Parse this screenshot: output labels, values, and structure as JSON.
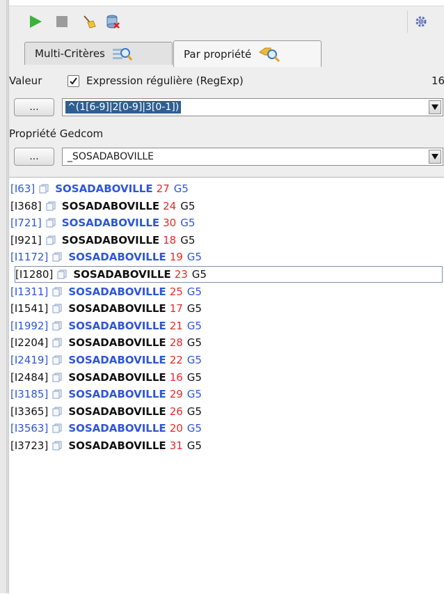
{
  "toolbar": {
    "icons": [
      "play-icon",
      "stop-icon",
      "broom-icon",
      "clear-database-icon",
      "settings-gear-icon"
    ]
  },
  "tabs": [
    {
      "label": "Multi-Critères",
      "icon": "magnifier-icon",
      "active": false
    },
    {
      "label": "Par propriété",
      "icon": "tag-magnifier-icon",
      "active": true
    }
  ],
  "form": {
    "value_label": "Valeur",
    "regexp_label": "Expression régulière (RegExp)",
    "regexp_checked": true,
    "count": "16",
    "value_button": "...",
    "value_field": "^(1[6-9]|2[0-9]|3[0-1])",
    "property_label": "Propriété Gedcom",
    "property_button": "...",
    "property_field": "_SOSADABOVILLE"
  },
  "results": [
    {
      "id": "[I63]",
      "prop": "SOSADABOVILLE",
      "num": "27",
      "gen": "G5",
      "color": "blue"
    },
    {
      "id": "[I368]",
      "prop": "SOSADABOVILLE",
      "num": "24",
      "gen": "G5",
      "color": "black"
    },
    {
      "id": "[I721]",
      "prop": "SOSADABOVILLE",
      "num": "30",
      "gen": "G5",
      "color": "blue"
    },
    {
      "id": "[I921]",
      "prop": "SOSADABOVILLE",
      "num": "18",
      "gen": "G5",
      "color": "black"
    },
    {
      "id": "[I1172]",
      "prop": "SOSADABOVILLE",
      "num": "19",
      "gen": "G5",
      "color": "blue"
    },
    {
      "id": "[I1280]",
      "prop": "SOSADABOVILLE",
      "num": "23",
      "gen": "G5",
      "color": "black",
      "focused": true
    },
    {
      "id": "[I1311]",
      "prop": "SOSADABOVILLE",
      "num": "25",
      "gen": "G5",
      "color": "blue"
    },
    {
      "id": "[I1541]",
      "prop": "SOSADABOVILLE",
      "num": "17",
      "gen": "G5",
      "color": "black"
    },
    {
      "id": "[I1992]",
      "prop": "SOSADABOVILLE",
      "num": "21",
      "gen": "G5",
      "color": "blue"
    },
    {
      "id": "[I2204]",
      "prop": "SOSADABOVILLE",
      "num": "28",
      "gen": "G5",
      "color": "black"
    },
    {
      "id": "[I2419]",
      "prop": "SOSADABOVILLE",
      "num": "22",
      "gen": "G5",
      "color": "blue"
    },
    {
      "id": "[I2484]",
      "prop": "SOSADABOVILLE",
      "num": "16",
      "gen": "G5",
      "color": "black"
    },
    {
      "id": "[I3185]",
      "prop": "SOSADABOVILLE",
      "num": "29",
      "gen": "G5",
      "color": "blue"
    },
    {
      "id": "[I3365]",
      "prop": "SOSADABOVILLE",
      "num": "26",
      "gen": "G5",
      "color": "black"
    },
    {
      "id": "[I3563]",
      "prop": "SOSADABOVILLE",
      "num": "20",
      "gen": "G5",
      "color": "blue"
    },
    {
      "id": "[I3723]",
      "prop": "SOSADABOVILLE",
      "num": "31",
      "gen": "G5",
      "color": "black"
    }
  ],
  "colors": {
    "blue_row": "#2d55d9",
    "number": "#e8282a",
    "selection": "#2f5f92"
  }
}
